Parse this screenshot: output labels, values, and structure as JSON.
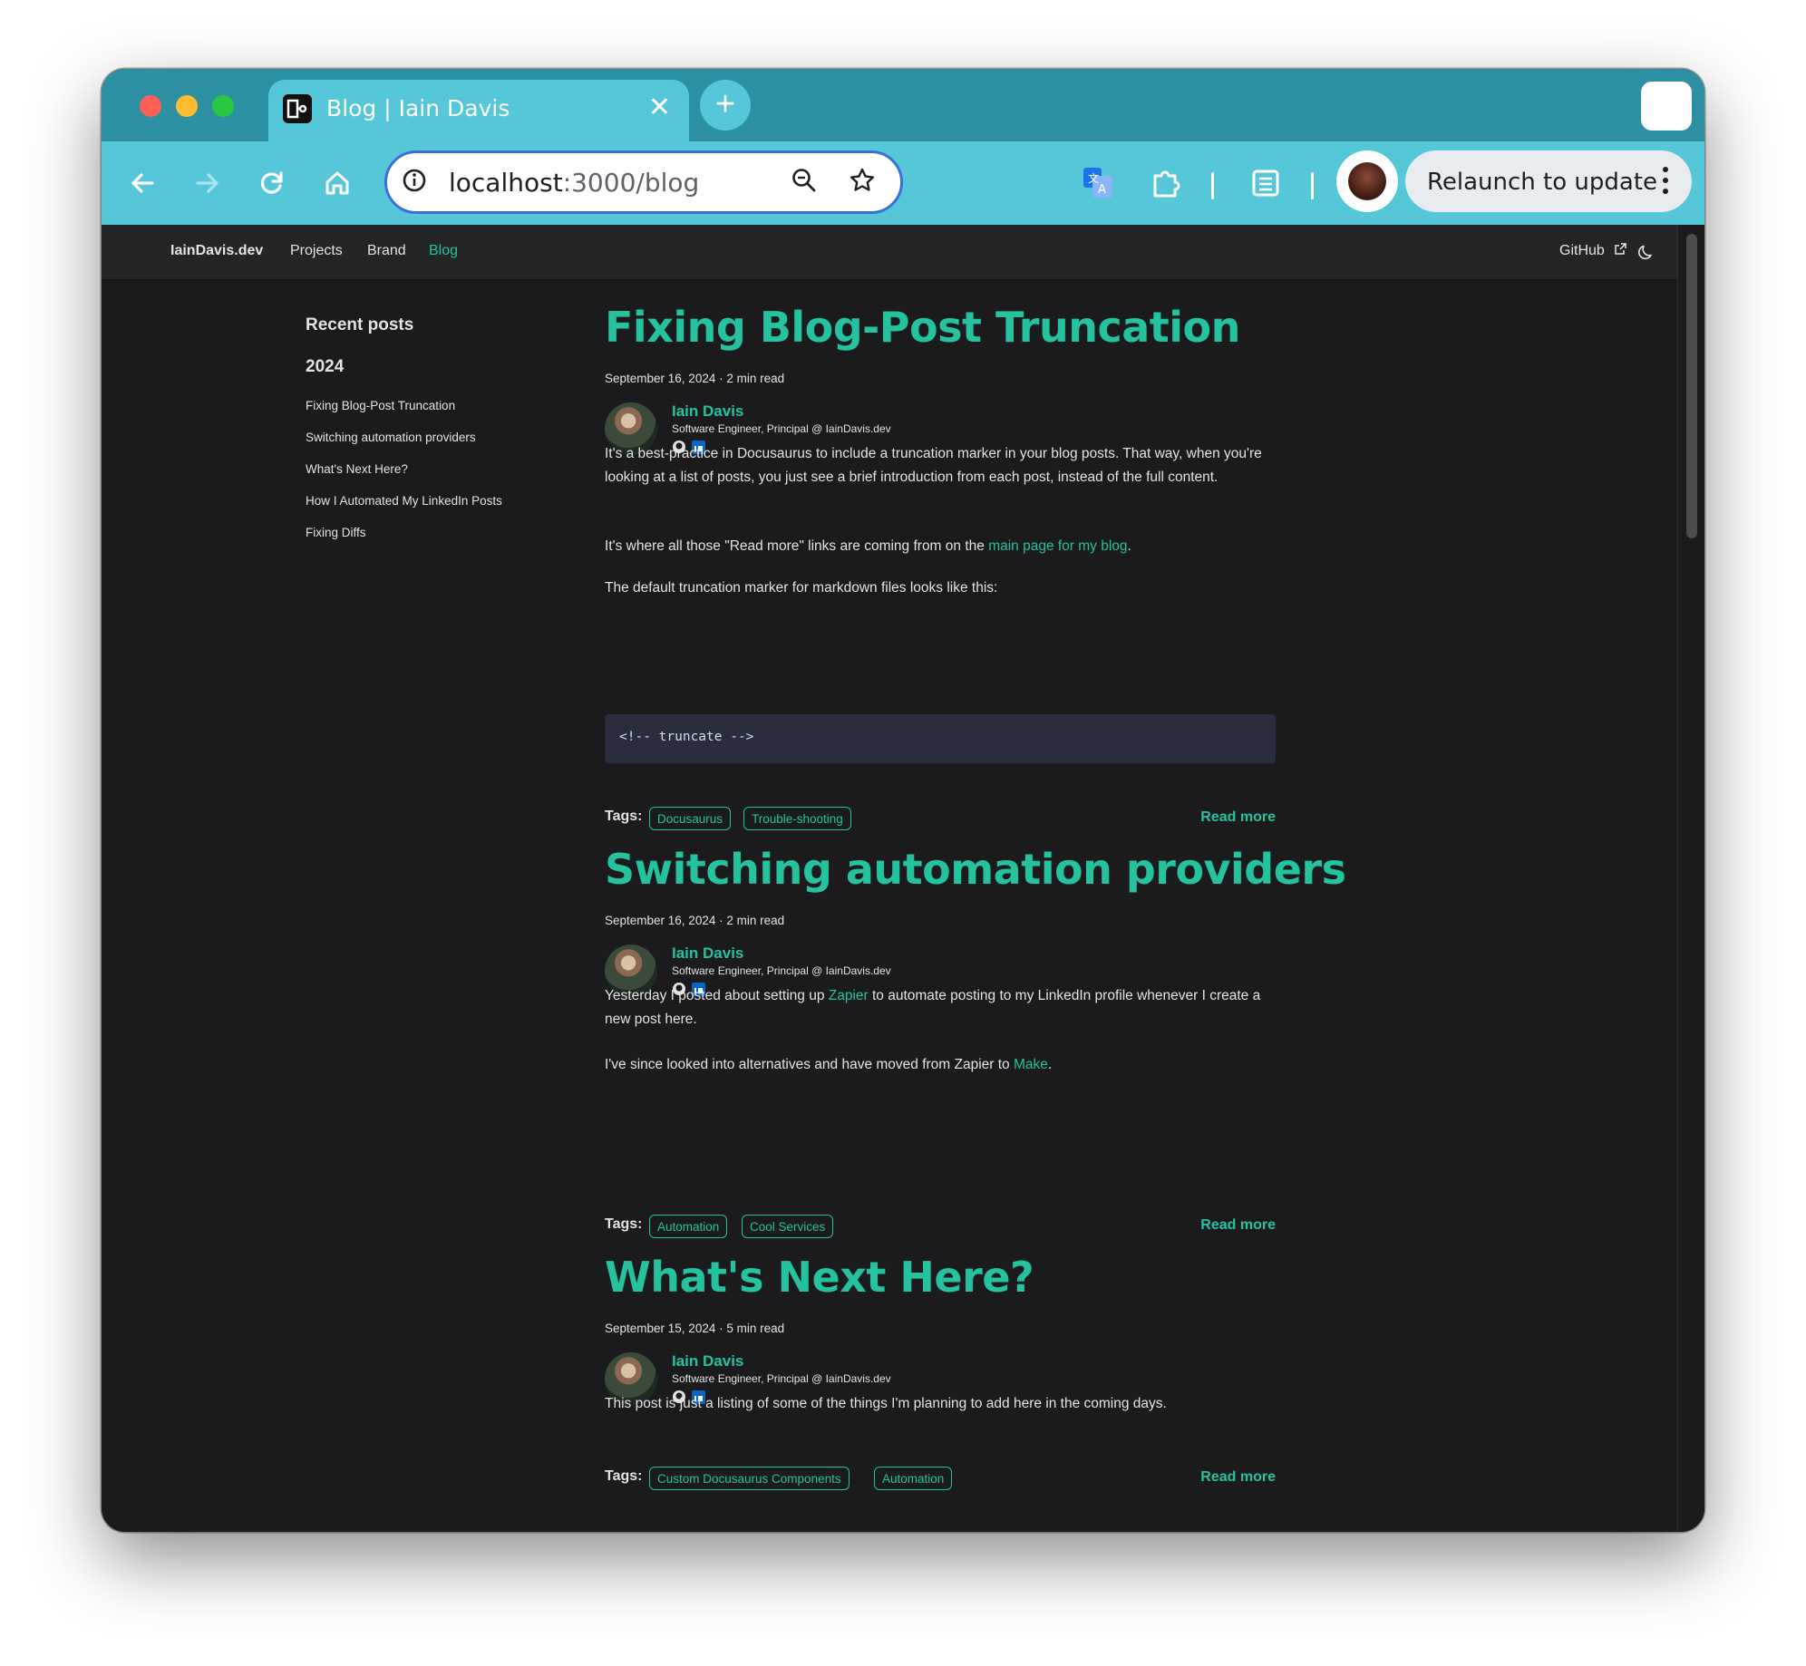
{
  "browser": {
    "tab_title": "Blog | Iain Davis",
    "tab_close": "✕",
    "new_tab": "+",
    "url_host": "localhost",
    "url_path": ":3000/blog",
    "relaunch_label": "Relaunch to update"
  },
  "navbar": {
    "brand": "IainDavis.dev",
    "links": [
      "Projects",
      "Brand",
      "Blog"
    ],
    "active_link": "Blog",
    "github": "GitHub"
  },
  "sidebar": {
    "title": "Recent posts",
    "year": "2024",
    "items": [
      "Fixing Blog-Post Truncation",
      "Switching automation providers",
      "What's Next Here?",
      "How I Automated My LinkedIn Posts",
      "Fixing Diffs"
    ]
  },
  "posts": [
    {
      "title": "Fixing Blog-Post Truncation",
      "meta": "September 16, 2024 · 2 min read",
      "author": "Iain Davis",
      "role": "Software Engineer, Principal @ IainDavis.dev",
      "p1": "It's a best-practice in Docusaurus to include a truncation marker in your blog posts. That way, when you're looking at a list of posts, you just see a brief introduction from each post, instead of the full content.",
      "p2_before": "It's where all those \"Read more\" links are coming from on the ",
      "p2_link": "main page for my blog",
      "p2_after": ".",
      "p3": "The default truncation marker for markdown files looks like this:",
      "code": "<!-- truncate -->",
      "tags_label": "Tags:",
      "tags": [
        "Docusaurus",
        "Trouble-shooting"
      ],
      "read_more": "Read more"
    },
    {
      "title": "Switching automation providers",
      "meta": "September 16, 2024 · 2 min read",
      "author": "Iain Davis",
      "role": "Software Engineer, Principal @ IainDavis.dev",
      "p1_before": "Yesterday I posted about setting up ",
      "p1_link": "Zapier",
      "p1_after": " to automate posting to my LinkedIn profile whenever I create a new post here.",
      "p2_before": "I've since looked into alternatives and have moved from Zapier to ",
      "p2_link": "Make",
      "p2_after": ".",
      "tags_label": "Tags:",
      "tags": [
        "Automation",
        "Cool Services"
      ],
      "read_more": "Read more"
    },
    {
      "title": "What's Next Here?",
      "meta": "September 15, 2024 · 5 min read",
      "author": "Iain Davis",
      "role": "Software Engineer, Principal @ IainDavis.dev",
      "p1": "This post is just a listing of some of the things I'm planning to add here in the coming days.",
      "tags_label": "Tags:",
      "tags": [
        "Custom Docusaurus Components",
        "Automation"
      ],
      "read_more": "Read more"
    }
  ],
  "colors": {
    "accent": "#25c2a0",
    "tabstrip": "#2d8fa2",
    "toolbar": "#56c7d9",
    "page_bg": "#1b1b1d"
  }
}
